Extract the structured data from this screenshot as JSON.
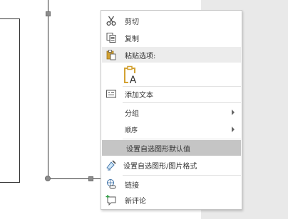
{
  "menu": {
    "items": [
      {
        "key": "cut",
        "label": "剪切",
        "icon": "scissors-icon"
      },
      {
        "key": "copy",
        "label": "复制",
        "icon": "copy-icon"
      },
      {
        "key": "paste_options",
        "label": "粘贴选项:",
        "icon": "paste-icon"
      },
      {
        "key": "add_text",
        "label": "添加文本",
        "icon": "add-text-icon"
      },
      {
        "key": "group",
        "label": "分组",
        "submenu": true
      },
      {
        "key": "order",
        "label": "顺序",
        "submenu": true
      },
      {
        "key": "set_default_shape",
        "label": "设置自选图形默认值"
      },
      {
        "key": "format_shape",
        "label": "设置自选图形/图片格式",
        "icon": "format-shape-icon"
      },
      {
        "key": "link",
        "label": "链接",
        "icon": "link-icon"
      },
      {
        "key": "new_comment",
        "label": "新评论",
        "icon": "new-comment-icon"
      }
    ],
    "paste_option_icon": "paste-keep-text-only-icon"
  },
  "colors": {
    "menu_text": "#333333",
    "section_bg": "#ececec",
    "hover_bg": "#c5c5c5",
    "icon_gold": "#d3a233",
    "icon_gray": "#595959",
    "gutter": "#e9e9e9"
  }
}
